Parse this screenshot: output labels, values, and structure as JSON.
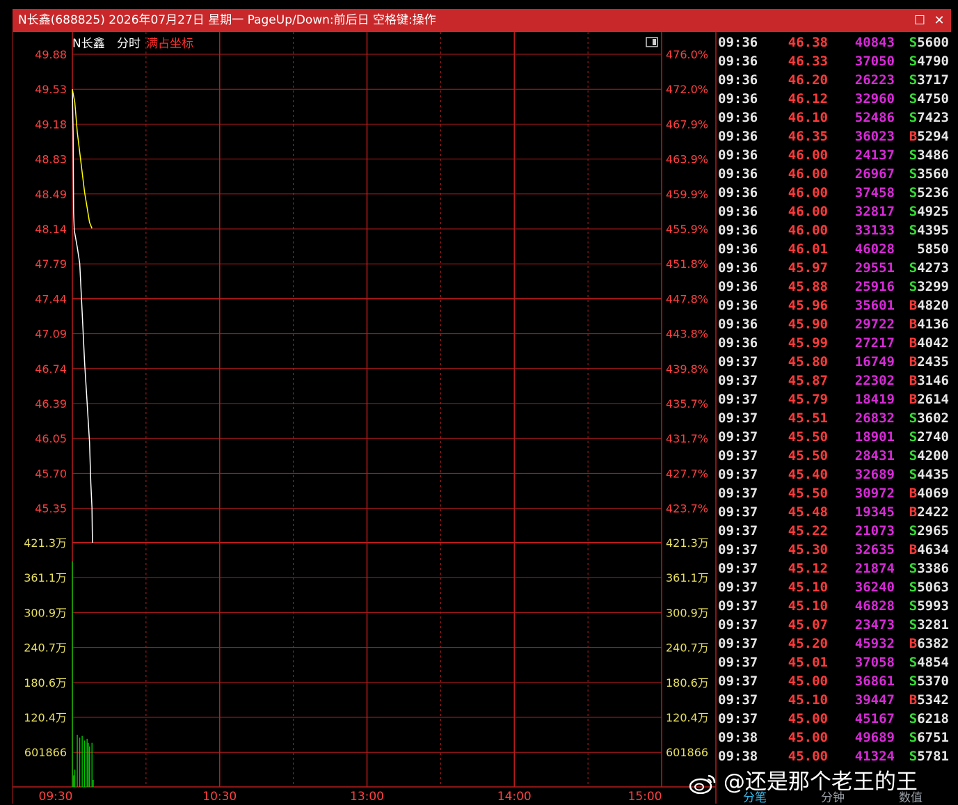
{
  "window": {
    "title": "N长鑫(688825) 2026年07月27日 星期一 PageUp/Down:前后日 空格键:操作",
    "maximize_glyph": "☐",
    "close_glyph": "✕"
  },
  "chart_header": {
    "name": "N长鑫",
    "mode": "分时",
    "option": "满占坐标"
  },
  "colors": {
    "grid": "#b81c1c",
    "price_line": "#ffffff",
    "avg_line": "#ffff00",
    "volume_bar": "#00c800",
    "axis_text": "#ff4040",
    "volume_axis_text": "#e8e060",
    "time_text": "#ff4040",
    "buy": "#ff3a3a",
    "sell": "#33dd33",
    "neutral": "#e6e6e6"
  },
  "chart_data": {
    "type": "line",
    "price_axis": {
      "ticks": [
        "49.88",
        "49.53",
        "49.18",
        "48.83",
        "48.49",
        "48.14",
        "47.79",
        "47.44",
        "47.09",
        "46.74",
        "46.39",
        "46.05",
        "45.70",
        "45.35"
      ],
      "ylim": [
        45.0,
        49.88
      ]
    },
    "pct_axis": {
      "ticks": [
        "476.0%",
        "472.0%",
        "467.9%",
        "463.9%",
        "459.9%",
        "455.9%",
        "451.8%",
        "447.8%",
        "443.8%",
        "439.8%",
        "435.7%",
        "431.7%",
        "427.7%",
        "423.7%"
      ]
    },
    "volume_axis": {
      "ticks": [
        "421.3万",
        "361.1万",
        "300.9万",
        "240.7万",
        "180.6万",
        "120.4万",
        "601866"
      ],
      "ylim": [
        0,
        4213000
      ]
    },
    "time_axis": {
      "labels": [
        "09:30",
        "10:30",
        "13:00",
        "14:00",
        "15:00"
      ],
      "session_minutes": 240
    },
    "series": [
      {
        "kind": "price",
        "points": [
          [
            0,
            49.53
          ],
          [
            0.3,
            49.1
          ],
          [
            0.5,
            48.3
          ],
          [
            0.8,
            48.12
          ],
          [
            2,
            47.95
          ],
          [
            3,
            47.79
          ],
          [
            4,
            47.3
          ],
          [
            5,
            46.8
          ],
          [
            6,
            46.4
          ],
          [
            7,
            46.0
          ],
          [
            7.5,
            45.6
          ],
          [
            8,
            45.35
          ],
          [
            8.2,
            45.0
          ]
        ]
      },
      {
        "kind": "avg",
        "points": [
          [
            0,
            49.53
          ],
          [
            1,
            49.4
          ],
          [
            2,
            49.1
          ],
          [
            3,
            48.9
          ],
          [
            4,
            48.7
          ],
          [
            5,
            48.5
          ],
          [
            6,
            48.35
          ],
          [
            7,
            48.2
          ],
          [
            8,
            48.14
          ]
        ]
      }
    ],
    "volume": [
      [
        0,
        3890000
      ],
      [
        0.5,
        200000
      ],
      [
        1,
        300000
      ],
      [
        2,
        900000
      ],
      [
        3,
        850000
      ],
      [
        4,
        880000
      ],
      [
        5,
        800000
      ],
      [
        6,
        830000
      ],
      [
        6.5,
        760000
      ],
      [
        7,
        700000
      ],
      [
        8,
        760000
      ],
      [
        8.5,
        120000
      ]
    ]
  },
  "ticks": [
    {
      "time": "09:36",
      "price": "46.38",
      "volume": "40843",
      "bs": "S5600"
    },
    {
      "time": "09:36",
      "price": "46.33",
      "volume": "37050",
      "bs": "S4790"
    },
    {
      "time": "09:36",
      "price": "46.20",
      "volume": "26223",
      "bs": "S3717"
    },
    {
      "time": "09:36",
      "price": "46.12",
      "volume": "32960",
      "bs": "S4750"
    },
    {
      "time": "09:36",
      "price": "46.10",
      "volume": "52486",
      "bs": "S7423"
    },
    {
      "time": "09:36",
      "price": "46.35",
      "volume": "36023",
      "bs": "B5294"
    },
    {
      "time": "09:36",
      "price": "46.00",
      "volume": "24137",
      "bs": "S3486"
    },
    {
      "time": "09:36",
      "price": "46.00",
      "volume": "26967",
      "bs": "S3560"
    },
    {
      "time": "09:36",
      "price": "46.00",
      "volume": "37458",
      "bs": "S5236"
    },
    {
      "time": "09:36",
      "price": "46.00",
      "volume": "32817",
      "bs": "S4925"
    },
    {
      "time": "09:36",
      "price": "46.00",
      "volume": "33133",
      "bs": "S4395"
    },
    {
      "time": "09:36",
      "price": "46.01",
      "volume": "46028",
      "bs": "5850"
    },
    {
      "time": "09:36",
      "price": "45.97",
      "volume": "29551",
      "bs": "S4273"
    },
    {
      "time": "09:36",
      "price": "45.88",
      "volume": "25916",
      "bs": "S3299"
    },
    {
      "time": "09:36",
      "price": "45.96",
      "volume": "35601",
      "bs": "B4820"
    },
    {
      "time": "09:36",
      "price": "45.90",
      "volume": "29722",
      "bs": "B4136"
    },
    {
      "time": "09:36",
      "price": "45.99",
      "volume": "27217",
      "bs": "B4042"
    },
    {
      "time": "09:37",
      "price": "45.80",
      "volume": "16749",
      "bs": "B2435"
    },
    {
      "time": "09:37",
      "price": "45.87",
      "volume": "22302",
      "bs": "B3146"
    },
    {
      "time": "09:37",
      "price": "45.79",
      "volume": "18419",
      "bs": "B2614"
    },
    {
      "time": "09:37",
      "price": "45.51",
      "volume": "26832",
      "bs": "S3602"
    },
    {
      "time": "09:37",
      "price": "45.50",
      "volume": "18901",
      "bs": "S2740"
    },
    {
      "time": "09:37",
      "price": "45.50",
      "volume": "28431",
      "bs": "S4200"
    },
    {
      "time": "09:37",
      "price": "45.40",
      "volume": "32689",
      "bs": "S4435"
    },
    {
      "time": "09:37",
      "price": "45.50",
      "volume": "30972",
      "bs": "B4069"
    },
    {
      "time": "09:37",
      "price": "45.48",
      "volume": "19345",
      "bs": "B2422"
    },
    {
      "time": "09:37",
      "price": "45.22",
      "volume": "21073",
      "bs": "S2965"
    },
    {
      "time": "09:37",
      "price": "45.30",
      "volume": "32635",
      "bs": "B4634"
    },
    {
      "time": "09:37",
      "price": "45.12",
      "volume": "21874",
      "bs": "S3386"
    },
    {
      "time": "09:37",
      "price": "45.10",
      "volume": "36240",
      "bs": "S5063"
    },
    {
      "time": "09:37",
      "price": "45.10",
      "volume": "46828",
      "bs": "S5993"
    },
    {
      "time": "09:37",
      "price": "45.07",
      "volume": "23473",
      "bs": "S3281"
    },
    {
      "time": "09:37",
      "price": "45.20",
      "volume": "45932",
      "bs": "B6382"
    },
    {
      "time": "09:37",
      "price": "45.01",
      "volume": "37058",
      "bs": "S4854"
    },
    {
      "time": "09:37",
      "price": "45.00",
      "volume": "36861",
      "bs": "S5370"
    },
    {
      "time": "09:37",
      "price": "45.10",
      "volume": "39447",
      "bs": "B5342"
    },
    {
      "time": "09:37",
      "price": "45.00",
      "volume": "45167",
      "bs": "S6218"
    },
    {
      "time": "09:38",
      "price": "45.00",
      "volume": "49689",
      "bs": "S6751"
    },
    {
      "time": "09:38",
      "price": "45.00",
      "volume": "41324",
      "bs": "S5781"
    }
  ],
  "bottom_tabs": {
    "tab1": "分笔",
    "tab2": "分钟",
    "tab3": "数值"
  },
  "watermark": {
    "text": "@还是那个老王的王"
  },
  "icons": {
    "maximize": "maximize-icon",
    "close": "close-icon",
    "toggle": "panel-toggle-icon",
    "weibo": "weibo-logo-icon"
  }
}
